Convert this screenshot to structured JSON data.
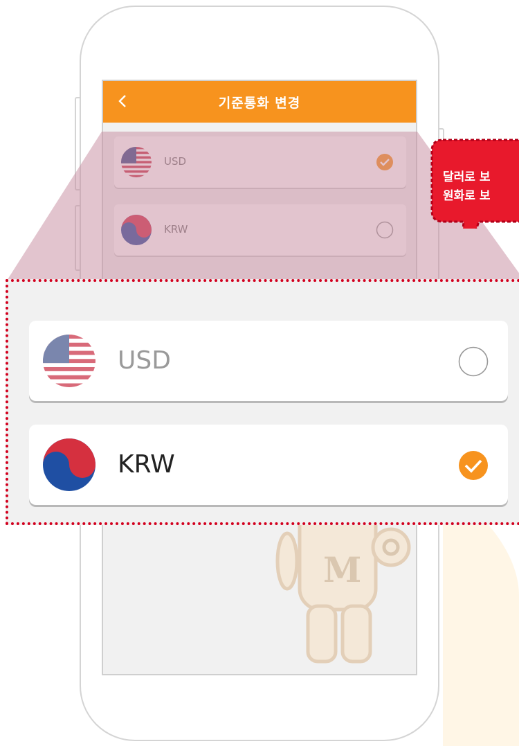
{
  "app": {
    "header_title": "기준통화 변경",
    "back_icon": "chevron-left-icon"
  },
  "currencies_small": [
    {
      "code": "USD",
      "flag": "us-flag-icon",
      "selected": true
    },
    {
      "code": "KRW",
      "flag": "kr-flag-icon",
      "selected": false
    }
  ],
  "zoomed": {
    "items": [
      {
        "code": "USD",
        "flag": "us-flag-icon",
        "selected": false
      },
      {
        "code": "KRW",
        "flag": "kr-flag-icon",
        "selected": true
      }
    ]
  },
  "callout": {
    "line1": "달러로 보",
    "line2": "원화로 보"
  },
  "colors": {
    "accent": "#f7931e",
    "callout": "#e8192c",
    "highlight_border": "#d2001e",
    "overlay": "#c58a9e"
  }
}
